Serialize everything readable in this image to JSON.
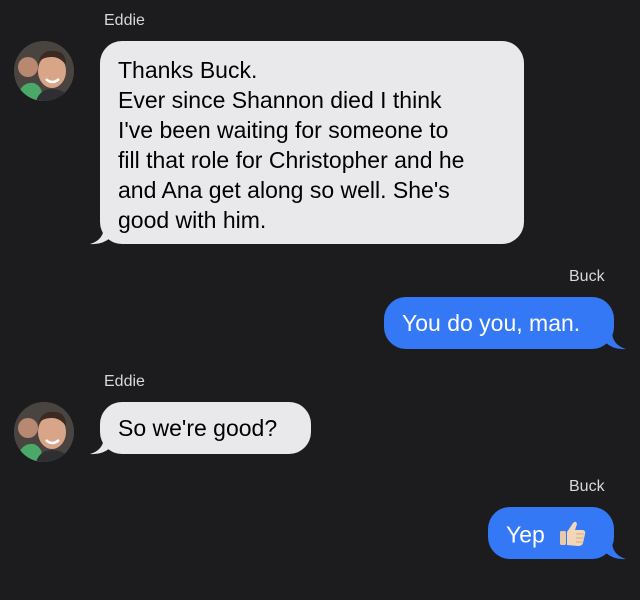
{
  "colors": {
    "background": "#1c1c1e",
    "incoming_bubble": "#e9e9eb",
    "outgoing_bubble": "#3478f6",
    "sender_name": "#d8d8dc"
  },
  "messages": [
    {
      "sender": "Eddie",
      "direction": "incoming",
      "avatar_icon": "contact-avatar-icon",
      "text": "Thanks Buck.\nEver since Shannon died I think\nI've been waiting for someone to\nfill that role for Christopher and he\nand Ana get along so well. She's\ngood with him."
    },
    {
      "sender": "Buck",
      "direction": "outgoing",
      "text": "You do you, man."
    },
    {
      "sender": "Eddie",
      "direction": "incoming",
      "avatar_icon": "contact-avatar-icon",
      "text": "So we're good?"
    },
    {
      "sender": "Buck",
      "direction": "outgoing",
      "text": "Yep",
      "emoji_icon": "thumbs-up-emoji-icon"
    }
  ]
}
